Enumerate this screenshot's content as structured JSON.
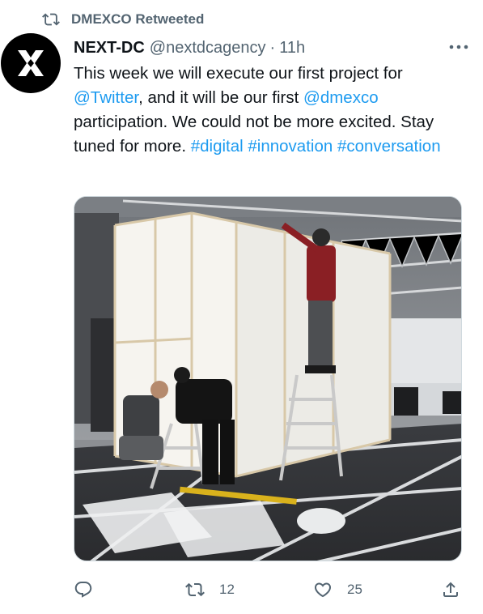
{
  "retweet": {
    "label": "DMEXCO Retweeted"
  },
  "tweet": {
    "author_name": "NEXT-DC",
    "handle": "@nextdcagency",
    "separator": "·",
    "time": "11h",
    "text": {
      "part1": "This week we will execute our first project for ",
      "mention1": "@Twitter",
      "part2": ", and it will be our first ",
      "mention2": "@dmexco",
      "part3": " participation. We could not be more excited. Stay tuned for more. ",
      "hashtag1": "#digital",
      "space1": " ",
      "hashtag2": "#innovation",
      "space2": " ",
      "hashtag3": "#conversation"
    },
    "media_alt": "Workers assembling a white booth structure in an exhibition hall"
  },
  "actions": {
    "reply_count": "",
    "retweet_count": "12",
    "like_count": "25"
  },
  "icons": {
    "retweet": "retweet-icon",
    "more": "more-dots-icon",
    "reply": "reply-icon",
    "like": "heart-icon",
    "share": "share-icon"
  },
  "colors": {
    "link": "#1d9bf0",
    "secondary": "#536471",
    "text": "#0f1419"
  }
}
